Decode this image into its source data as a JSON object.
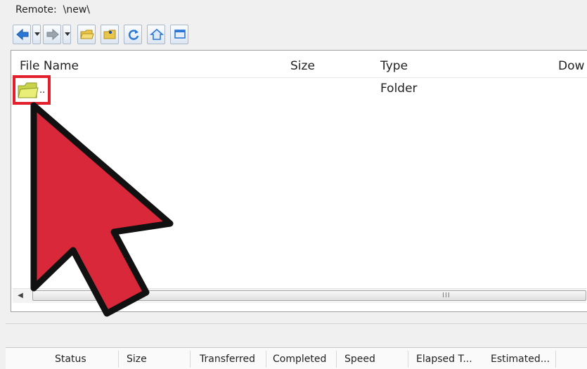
{
  "remote": {
    "label": "Remote:",
    "path": "\\new\\"
  },
  "toolbar": {
    "buttons": [
      {
        "icon": "back-arrow-icon"
      },
      {
        "icon": "chevron-down-icon"
      },
      {
        "icon": "forward-arrow-icon"
      },
      {
        "icon": "chevron-down-icon"
      },
      {
        "icon": "open-folder-icon"
      },
      {
        "icon": "new-folder-icon"
      },
      {
        "icon": "refresh-icon"
      },
      {
        "icon": "home-icon"
      },
      {
        "icon": "window-icon"
      }
    ]
  },
  "file_list": {
    "columns": [
      "File Name",
      "Size",
      "Type",
      "Dow"
    ],
    "rows": [
      {
        "name": "..",
        "size": "",
        "type": "Folder"
      }
    ],
    "scroll_grip": "III"
  },
  "queue": {
    "columns": [
      "Status",
      "Size",
      "Transferred",
      "Completed",
      "Speed",
      "Elapsed T...",
      "Estimated..."
    ]
  },
  "colors": {
    "highlight": "#e21f2a",
    "pointer": "#d9283a"
  }
}
